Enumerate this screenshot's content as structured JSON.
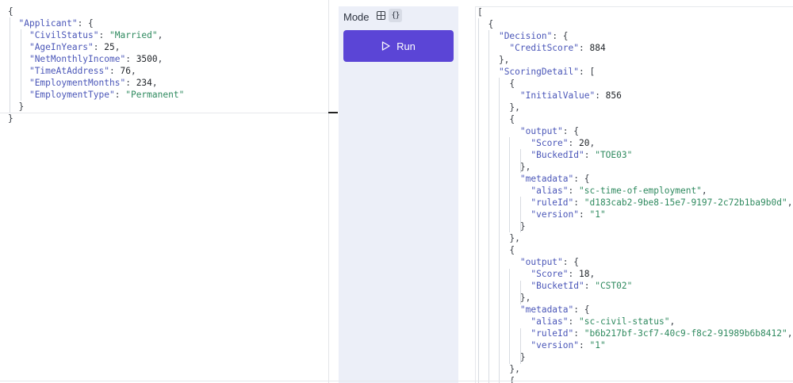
{
  "mode": {
    "label": "Mode",
    "options": [
      "table-icon",
      "braces-icon"
    ],
    "selected": "braces-icon"
  },
  "run_button": {
    "label": "Run"
  },
  "input_json": [
    [
      {
        "t": "{",
        "c": "p"
      }
    ],
    [
      {
        "t": "  ",
        "c": "p"
      },
      {
        "t": "\"Applicant\"",
        "c": "k"
      },
      {
        "t": ": {",
        "c": "p"
      }
    ],
    [
      {
        "t": "    ",
        "c": "p"
      },
      {
        "t": "\"CivilStatus\"",
        "c": "k"
      },
      {
        "t": ": ",
        "c": "p"
      },
      {
        "t": "\"Married\"",
        "c": "s"
      },
      {
        "t": ",",
        "c": "p"
      }
    ],
    [
      {
        "t": "    ",
        "c": "p"
      },
      {
        "t": "\"AgeInYears\"",
        "c": "k"
      },
      {
        "t": ": ",
        "c": "p"
      },
      {
        "t": "25",
        "c": "n"
      },
      {
        "t": ",",
        "c": "p"
      }
    ],
    [
      {
        "t": "    ",
        "c": "p"
      },
      {
        "t": "\"NetMonthlyIncome\"",
        "c": "k"
      },
      {
        "t": ": ",
        "c": "p"
      },
      {
        "t": "3500",
        "c": "n"
      },
      {
        "t": ",",
        "c": "p"
      }
    ],
    [
      {
        "t": "    ",
        "c": "p"
      },
      {
        "t": "\"TimeAtAddress\"",
        "c": "k"
      },
      {
        "t": ": ",
        "c": "p"
      },
      {
        "t": "76",
        "c": "n"
      },
      {
        "t": ",",
        "c": "p"
      }
    ],
    [
      {
        "t": "    ",
        "c": "p"
      },
      {
        "t": "\"EmploymentMonths\"",
        "c": "k"
      },
      {
        "t": ": ",
        "c": "p"
      },
      {
        "t": "234",
        "c": "n"
      },
      {
        "t": ",",
        "c": "p"
      }
    ],
    [
      {
        "t": "    ",
        "c": "p"
      },
      {
        "t": "\"EmploymentType\"",
        "c": "k"
      },
      {
        "t": ": ",
        "c": "p"
      },
      {
        "t": "\"Permanent\"",
        "c": "s"
      }
    ],
    [
      {
        "t": "  }",
        "c": "p"
      }
    ],
    [
      {
        "t": "}",
        "c": "p"
      }
    ]
  ],
  "output_json": [
    [
      {
        "t": "[",
        "c": "p"
      }
    ],
    [
      {
        "t": "  {",
        "c": "p"
      }
    ],
    [
      {
        "t": "    ",
        "c": "p"
      },
      {
        "t": "\"Decision\"",
        "c": "k"
      },
      {
        "t": ": {",
        "c": "p"
      }
    ],
    [
      {
        "t": "      ",
        "c": "p"
      },
      {
        "t": "\"CreditScore\"",
        "c": "k"
      },
      {
        "t": ": ",
        "c": "p"
      },
      {
        "t": "884",
        "c": "n"
      }
    ],
    [
      {
        "t": "    },",
        "c": "p"
      }
    ],
    [
      {
        "t": "    ",
        "c": "p"
      },
      {
        "t": "\"ScoringDetail\"",
        "c": "k"
      },
      {
        "t": ": [",
        "c": "p"
      }
    ],
    [
      {
        "t": "      {",
        "c": "p"
      }
    ],
    [
      {
        "t": "        ",
        "c": "p"
      },
      {
        "t": "\"InitialValue\"",
        "c": "k"
      },
      {
        "t": ": ",
        "c": "p"
      },
      {
        "t": "856",
        "c": "n"
      }
    ],
    [
      {
        "t": "      },",
        "c": "p"
      }
    ],
    [
      {
        "t": "      {",
        "c": "p"
      }
    ],
    [
      {
        "t": "        ",
        "c": "p"
      },
      {
        "t": "\"output\"",
        "c": "k"
      },
      {
        "t": ": {",
        "c": "p"
      }
    ],
    [
      {
        "t": "          ",
        "c": "p"
      },
      {
        "t": "\"Score\"",
        "c": "k"
      },
      {
        "t": ": ",
        "c": "p"
      },
      {
        "t": "20",
        "c": "n"
      },
      {
        "t": ",",
        "c": "p"
      }
    ],
    [
      {
        "t": "          ",
        "c": "p"
      },
      {
        "t": "\"BuckedId\"",
        "c": "k"
      },
      {
        "t": ": ",
        "c": "p"
      },
      {
        "t": "\"TOE03\"",
        "c": "s"
      }
    ],
    [
      {
        "t": "        },",
        "c": "p"
      }
    ],
    [
      {
        "t": "        ",
        "c": "p"
      },
      {
        "t": "\"metadata\"",
        "c": "k"
      },
      {
        "t": ": {",
        "c": "p"
      }
    ],
    [
      {
        "t": "          ",
        "c": "p"
      },
      {
        "t": "\"alias\"",
        "c": "k"
      },
      {
        "t": ": ",
        "c": "p"
      },
      {
        "t": "\"sc-time-of-employment\"",
        "c": "s"
      },
      {
        "t": ",",
        "c": "p"
      }
    ],
    [
      {
        "t": "          ",
        "c": "p"
      },
      {
        "t": "\"ruleId\"",
        "c": "k"
      },
      {
        "t": ": ",
        "c": "p"
      },
      {
        "t": "\"d183cab2-9be8-15e7-9197-2c72b1ba9b0d\"",
        "c": "s"
      },
      {
        "t": ",",
        "c": "p"
      }
    ],
    [
      {
        "t": "          ",
        "c": "p"
      },
      {
        "t": "\"version\"",
        "c": "k"
      },
      {
        "t": ": ",
        "c": "p"
      },
      {
        "t": "\"1\"",
        "c": "s"
      }
    ],
    [
      {
        "t": "        }",
        "c": "p"
      }
    ],
    [
      {
        "t": "      },",
        "c": "p"
      }
    ],
    [
      {
        "t": "      {",
        "c": "p"
      }
    ],
    [
      {
        "t": "        ",
        "c": "p"
      },
      {
        "t": "\"output\"",
        "c": "k"
      },
      {
        "t": ": {",
        "c": "p"
      }
    ],
    [
      {
        "t": "          ",
        "c": "p"
      },
      {
        "t": "\"Score\"",
        "c": "k"
      },
      {
        "t": ": ",
        "c": "p"
      },
      {
        "t": "18",
        "c": "n"
      },
      {
        "t": ",",
        "c": "p"
      }
    ],
    [
      {
        "t": "          ",
        "c": "p"
      },
      {
        "t": "\"BucketId\"",
        "c": "k"
      },
      {
        "t": ": ",
        "c": "p"
      },
      {
        "t": "\"CST02\"",
        "c": "s"
      }
    ],
    [
      {
        "t": "        },",
        "c": "p"
      }
    ],
    [
      {
        "t": "        ",
        "c": "p"
      },
      {
        "t": "\"metadata\"",
        "c": "k"
      },
      {
        "t": ": {",
        "c": "p"
      }
    ],
    [
      {
        "t": "          ",
        "c": "p"
      },
      {
        "t": "\"alias\"",
        "c": "k"
      },
      {
        "t": ": ",
        "c": "p"
      },
      {
        "t": "\"sc-civil-status\"",
        "c": "s"
      },
      {
        "t": ",",
        "c": "p"
      }
    ],
    [
      {
        "t": "          ",
        "c": "p"
      },
      {
        "t": "\"ruleId\"",
        "c": "k"
      },
      {
        "t": ": ",
        "c": "p"
      },
      {
        "t": "\"b6b217bf-3cf7-40c9-f8c2-91989b6b8412\"",
        "c": "s"
      },
      {
        "t": ",",
        "c": "p"
      }
    ],
    [
      {
        "t": "          ",
        "c": "p"
      },
      {
        "t": "\"version\"",
        "c": "k"
      },
      {
        "t": ": ",
        "c": "p"
      },
      {
        "t": "\"1\"",
        "c": "s"
      }
    ],
    [
      {
        "t": "        }",
        "c": "p"
      }
    ],
    [
      {
        "t": "      },",
        "c": "p"
      }
    ],
    [
      {
        "t": "      {",
        "c": "p"
      }
    ]
  ]
}
